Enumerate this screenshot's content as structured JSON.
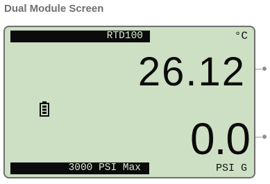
{
  "screen_title": "Dual Module Screen",
  "lcd": {
    "top_module": {
      "label": "RTD100",
      "unit": "°C",
      "reading": "26.12"
    },
    "bottom_module": {
      "label": "3000 PSI Max",
      "unit": "PSI G",
      "reading": "0.0"
    },
    "icons": {
      "status": "battery-icon"
    }
  },
  "colors": {
    "lcd_background": "#cde0c3",
    "bar_background": "#0b0b0b",
    "bar_text": "#d7e8cf",
    "frame": "#6e6e6e",
    "callout": "#8f8f8f"
  }
}
